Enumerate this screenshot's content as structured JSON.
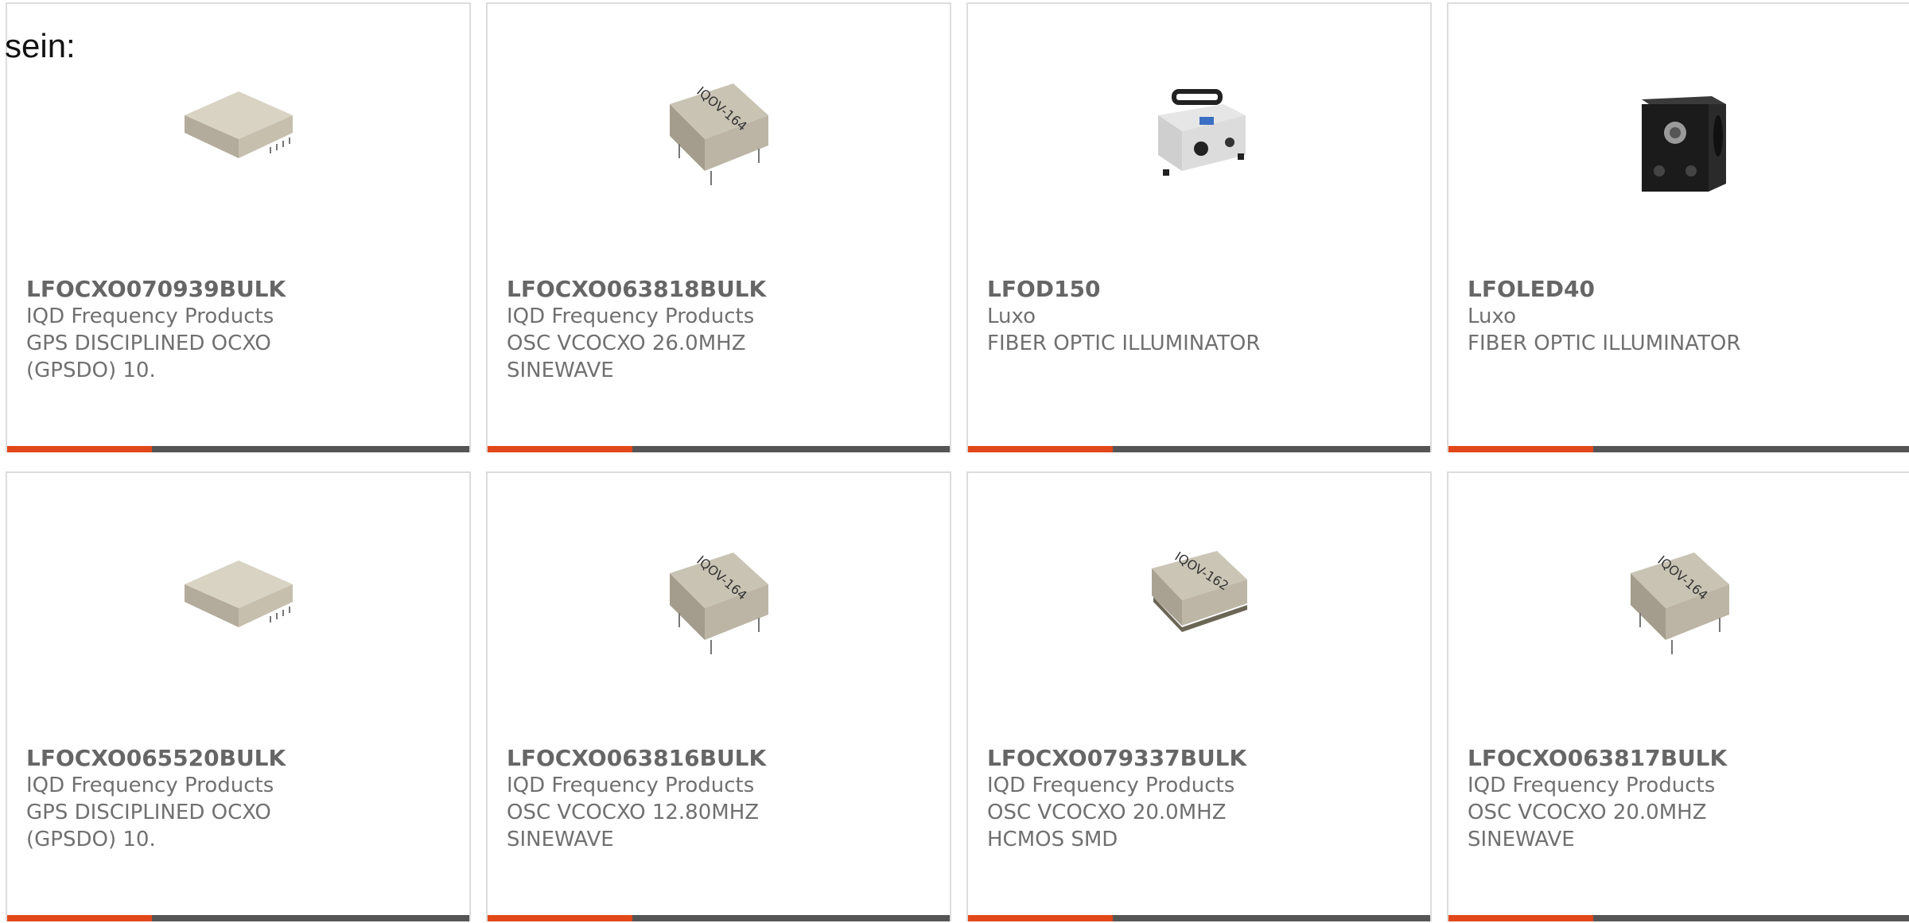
{
  "intro_text": "sein:",
  "colors": {
    "accent": "#e2471a",
    "bar": "#555555",
    "border": "#dcdcdc",
    "text": "#666666"
  },
  "products": [
    {
      "part": "LFOCXO070939BULK",
      "manufacturer": "IQD Frequency Products",
      "description": "GPS DISCIPLINED OCXO (GPSDO) 10.",
      "image_icon": "ocxo-flat-package-icon",
      "image_label": ""
    },
    {
      "part": "LFOCXO063818BULK",
      "manufacturer": "IQD Frequency Products",
      "description": "OSC VCOCXO 26.0MHZ SINEWAVE",
      "image_icon": "oscillator-package-icon",
      "image_label": "IQOV-164"
    },
    {
      "part": "LFOD150",
      "manufacturer": "Luxo",
      "description": "FIBER OPTIC ILLUMINATOR",
      "image_icon": "illuminator-white-icon",
      "image_label": ""
    },
    {
      "part": "LFOLED40",
      "manufacturer": "Luxo",
      "description": "FIBER OPTIC ILLUMINATOR",
      "image_icon": "illuminator-black-icon",
      "image_label": ""
    },
    {
      "part": "LFOCXO065520BULK",
      "manufacturer": "IQD Frequency Products",
      "description": "GPS DISCIPLINED OCXO (GPSDO) 10.",
      "image_icon": "ocxo-flat-package-icon",
      "image_label": ""
    },
    {
      "part": "LFOCXO063816BULK",
      "manufacturer": "IQD Frequency Products",
      "description": "OSC VCOCXO 12.80MHZ SINEWAVE",
      "image_icon": "oscillator-package-icon",
      "image_label": "IQOV-164"
    },
    {
      "part": "LFOCXO079337BULK",
      "manufacturer": "IQD Frequency Products",
      "description": "OSC VCOCXO 20.0MHZ HCMOS SMD",
      "image_icon": "oscillator-smd-package-icon",
      "image_label": "IQOV-162"
    },
    {
      "part": "LFOCXO063817BULK",
      "manufacturer": "IQD Frequency Products",
      "description": "OSC VCOCXO 20.0MHZ SINEWAVE",
      "image_icon": "oscillator-package-icon",
      "image_label": "IQOV-164"
    }
  ]
}
